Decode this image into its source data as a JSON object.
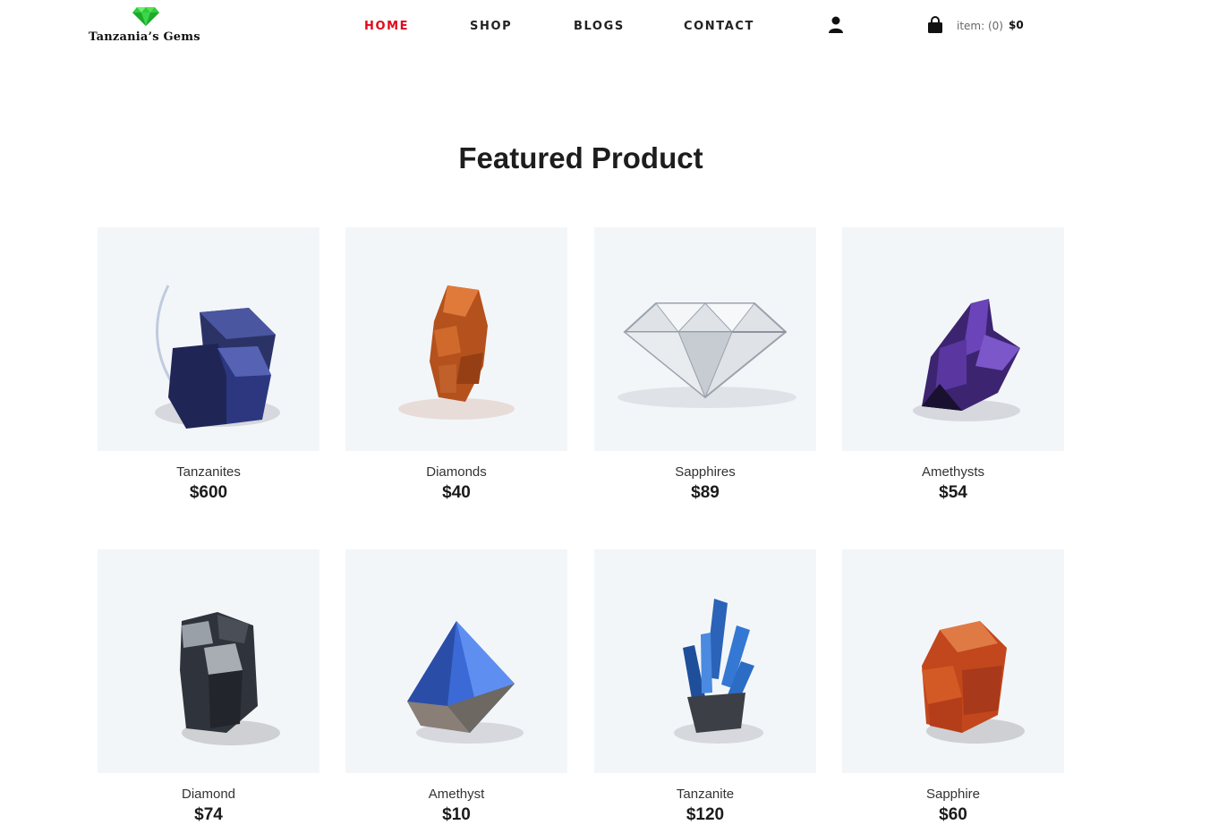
{
  "brand": {
    "name": "Tanzania’s Gems",
    "logo_icon": "green-gem-icon"
  },
  "nav": {
    "items": [
      {
        "label": "HOME",
        "active": true
      },
      {
        "label": "SHOP",
        "active": false
      },
      {
        "label": "BLOGS",
        "active": false
      },
      {
        "label": "CONTACT",
        "active": false
      }
    ],
    "active_color": "#e10a1b"
  },
  "header": {
    "account_icon": "user-icon",
    "cart_icon": "shopping-bag-icon",
    "cart_label": "item: (0)",
    "cart_total": "$0"
  },
  "featured": {
    "title": "Featured Product",
    "products": [
      {
        "name": "Tanzanites",
        "price": "$600",
        "gem": "dark-blue-cube-cluster",
        "color": "#2b3366"
      },
      {
        "name": "Diamonds",
        "price": "$40",
        "gem": "orange-crystal-cluster",
        "color": "#b4511d"
      },
      {
        "name": "Sapphires",
        "price": "$89",
        "gem": "clear-cut-diamond",
        "color": "#dfe3e8"
      },
      {
        "name": "Amethysts",
        "price": "$54",
        "gem": "purple-crystal-shards",
        "color": "#4a2a80"
      },
      {
        "name": "Diamond",
        "price": "$74",
        "gem": "dark-metallic-cubes",
        "color": "#3a3f48"
      },
      {
        "name": "Amethyst",
        "price": "$10",
        "gem": "blue-pyramid-crystal",
        "color": "#3b6ad6"
      },
      {
        "name": "Tanzanite",
        "price": "$120",
        "gem": "blue-crystal-spikes",
        "color": "#2a63b8"
      },
      {
        "name": "Sapphire",
        "price": "$60",
        "gem": "orange-red-cubes",
        "color": "#c2471c"
      }
    ]
  }
}
